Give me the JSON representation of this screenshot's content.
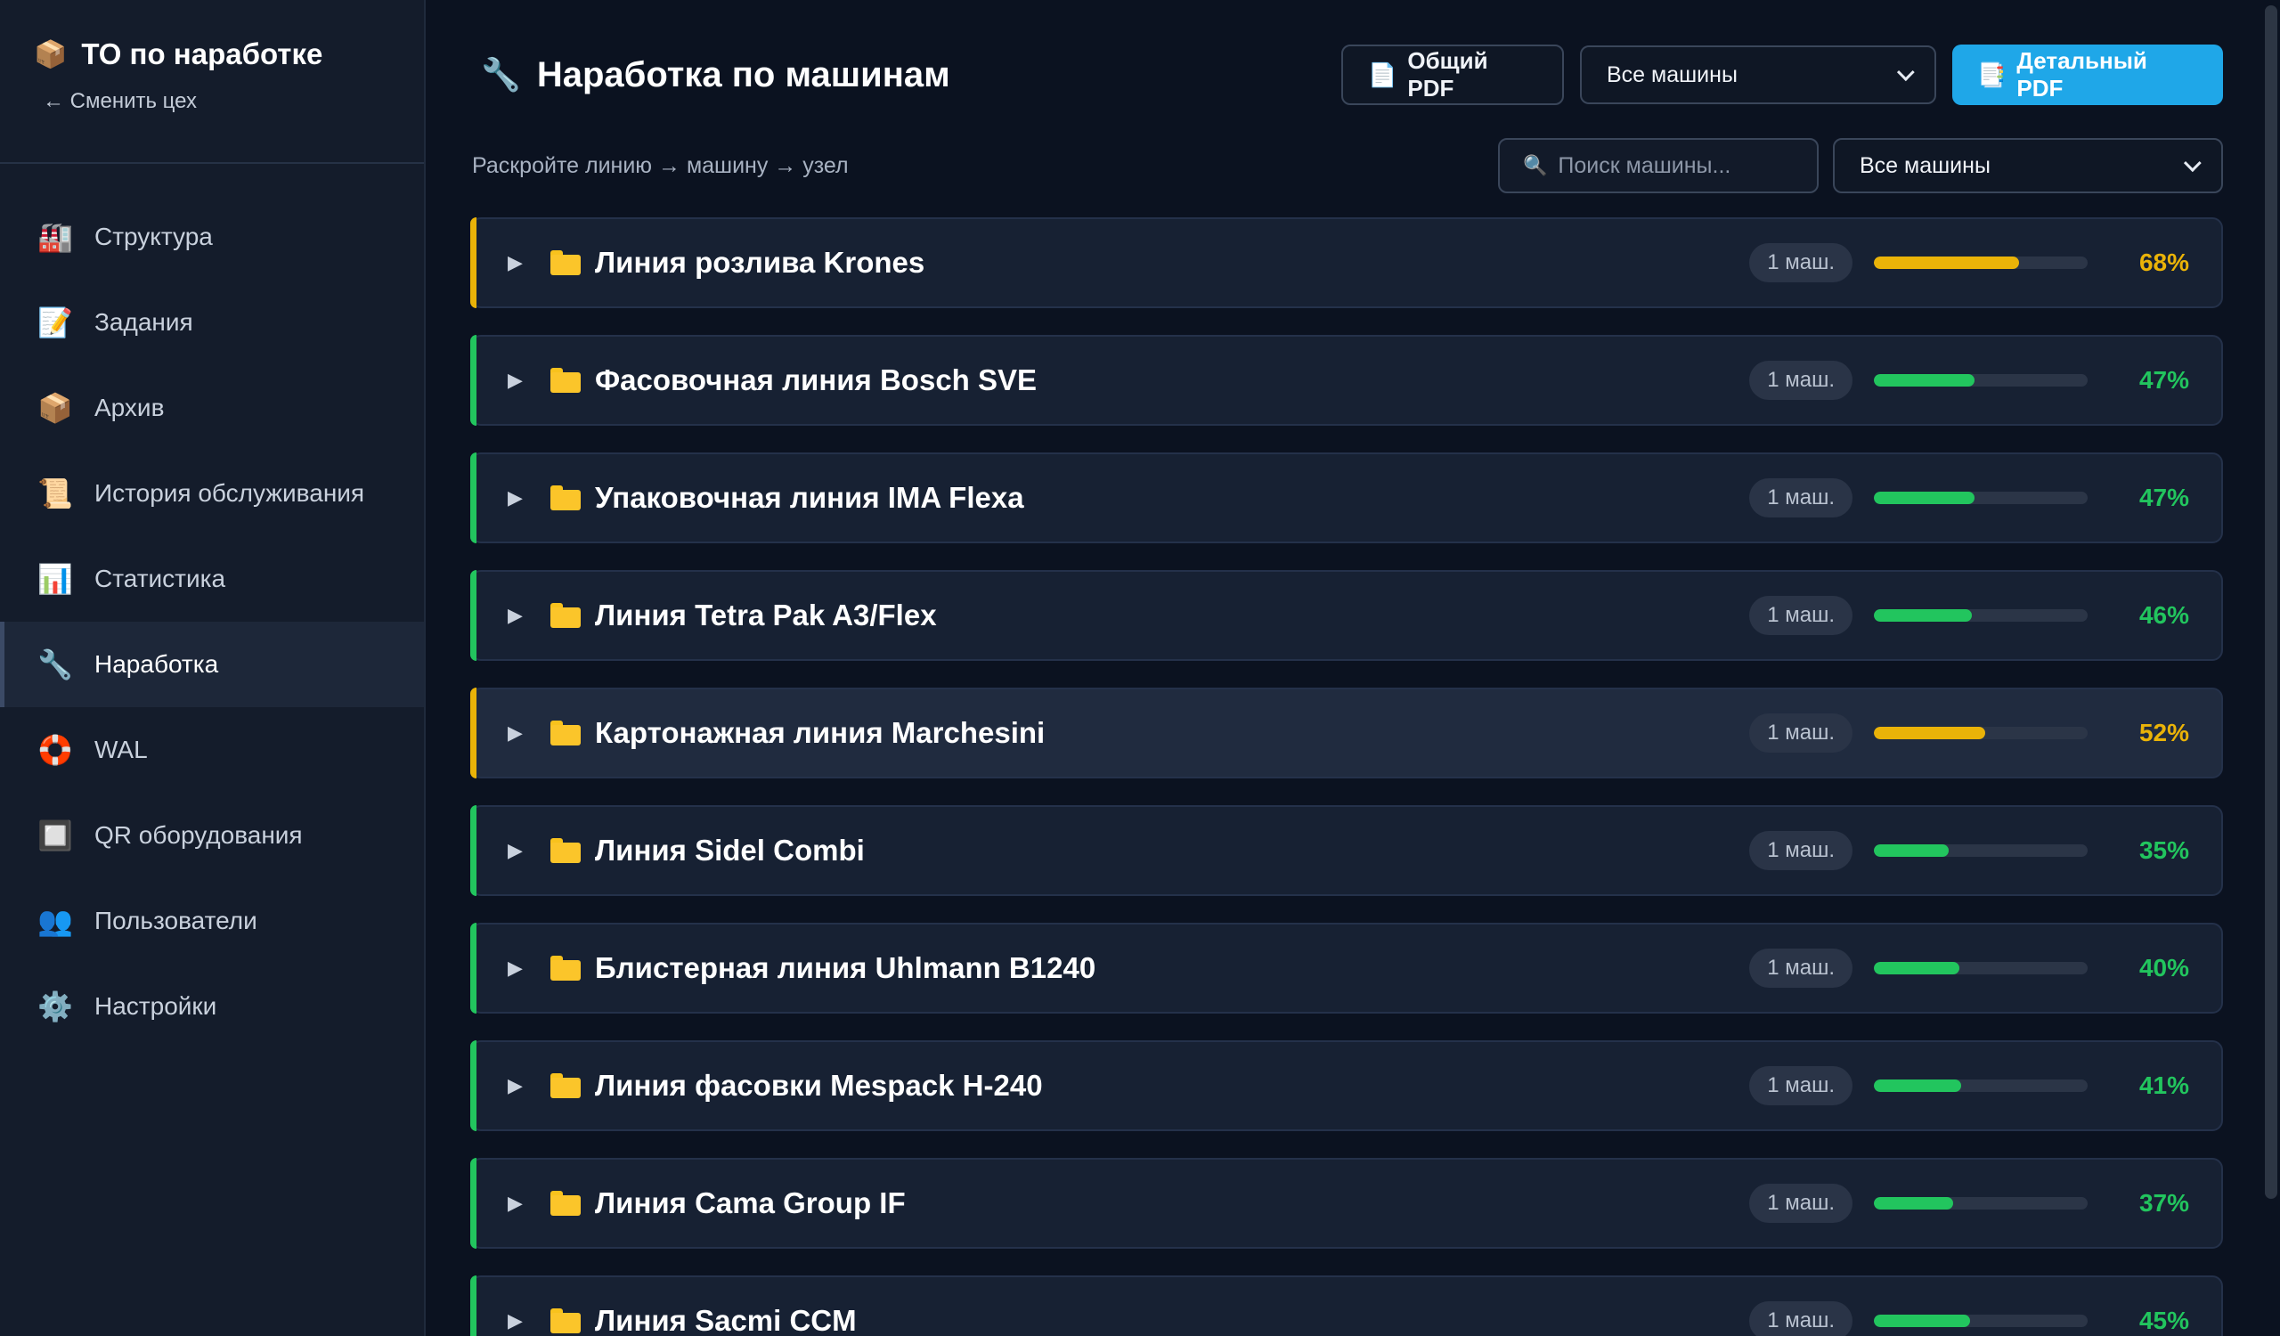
{
  "sidebar": {
    "title": "ТО по наработке",
    "back_link": "← Сменить цех",
    "items": [
      {
        "label": "Структура",
        "icon": "🏭"
      },
      {
        "label": "Задания",
        "icon": "📝"
      },
      {
        "label": "Архив",
        "icon": "📦"
      },
      {
        "label": "История обслуживания",
        "icon": "📜"
      },
      {
        "label": "Статистика",
        "icon": "📊"
      },
      {
        "label": "Наработка",
        "icon": "🔧"
      },
      {
        "label": "WAL",
        "icon": "🛟"
      },
      {
        "label": "QR оборудования",
        "icon": "🔲"
      },
      {
        "label": "Пользователи",
        "icon": "👥"
      },
      {
        "label": "Настройки",
        "icon": "⚙️"
      }
    ],
    "active_index": 5
  },
  "header": {
    "title": "Наработка по машинам",
    "general_pdf": "Общий PDF",
    "machine_select": "Все машины",
    "detailed_pdf": "Детальный PDF"
  },
  "subheader": {
    "hint": "Раскройте линию → машину → узел",
    "search_placeholder": "Поиск машины...",
    "filter_select": "Все машины"
  },
  "colors": {
    "green": "#22c55e",
    "yellow": "#eab308",
    "accent_blue": "#1fa7e8"
  },
  "lines": [
    {
      "name": "Линия розлива Krones",
      "count": "1 маш.",
      "percent": 68,
      "status": "yellow",
      "highlight": false
    },
    {
      "name": "Фасовочная линия Bosch SVE",
      "count": "1 маш.",
      "percent": 47,
      "status": "green",
      "highlight": false
    },
    {
      "name": "Упаковочная линия IMA Flexa",
      "count": "1 маш.",
      "percent": 47,
      "status": "green",
      "highlight": false
    },
    {
      "name": "Линия Tetra Pak A3/Flex",
      "count": "1 маш.",
      "percent": 46,
      "status": "green",
      "highlight": false
    },
    {
      "name": "Картонажная линия Marchesini",
      "count": "1 маш.",
      "percent": 52,
      "status": "yellow",
      "highlight": true
    },
    {
      "name": "Линия Sidel Combi",
      "count": "1 маш.",
      "percent": 35,
      "status": "green",
      "highlight": false
    },
    {
      "name": "Блистерная линия Uhlmann B1240",
      "count": "1 маш.",
      "percent": 40,
      "status": "green",
      "highlight": false
    },
    {
      "name": "Линия фасовки Mespack H-240",
      "count": "1 маш.",
      "percent": 41,
      "status": "green",
      "highlight": false
    },
    {
      "name": "Линия Cama Group IF",
      "count": "1 маш.",
      "percent": 37,
      "status": "green",
      "highlight": false
    },
    {
      "name": "Линия Sacmi CCM",
      "count": "1 маш.",
      "percent": 45,
      "status": "green",
      "highlight": false
    }
  ]
}
